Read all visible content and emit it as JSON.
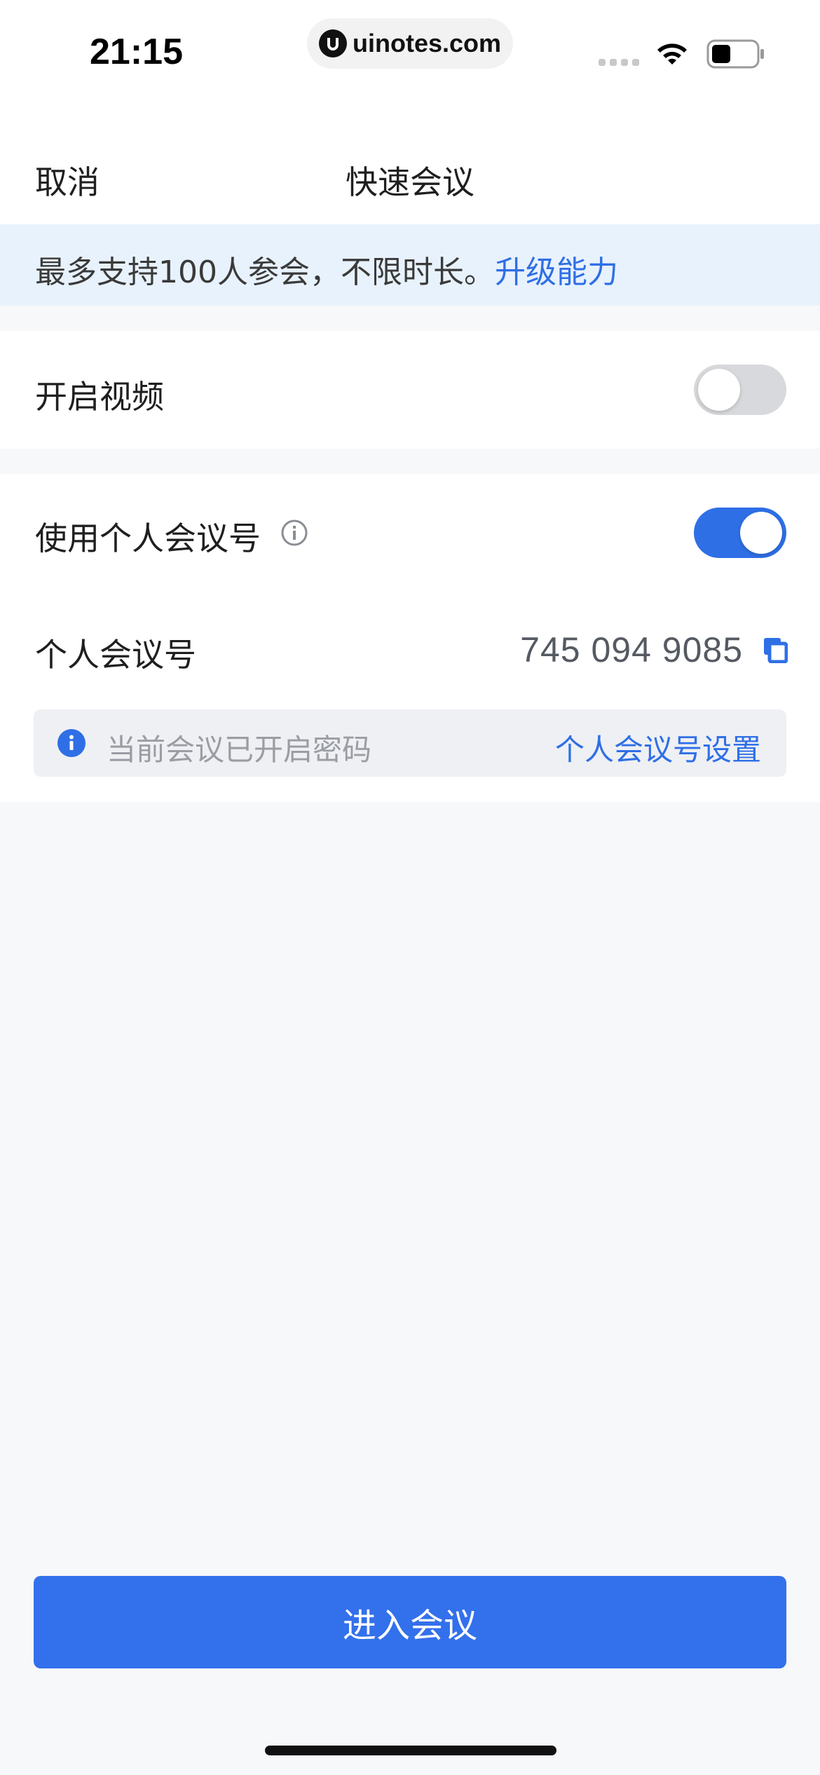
{
  "status_bar": {
    "time": "21:15",
    "url": "uinotes.com",
    "icons": [
      "signal-icon",
      "wifi-icon",
      "battery-icon"
    ]
  },
  "nav": {
    "cancel_label": "取消",
    "title": "快速会议"
  },
  "banner": {
    "text": "最多支持100人参会，不限时长。",
    "link_label": "升级能力"
  },
  "video_setting": {
    "label": "开启视频",
    "enabled": false
  },
  "pmi_setting": {
    "label": "使用个人会议号",
    "enabled": true,
    "number_label": "个人会议号",
    "number_value": "745 094 9085",
    "notice_text": "当前会议已开启密码",
    "notice_link": "个人会议号设置"
  },
  "join_button_label": "进入会议",
  "colors": {
    "accent": "#3370eb",
    "link": "#2f6fe6",
    "banner_bg": "#e8f2fd",
    "page_bg": "#f7f8fa",
    "toggle_off": "#d8d9dc"
  }
}
